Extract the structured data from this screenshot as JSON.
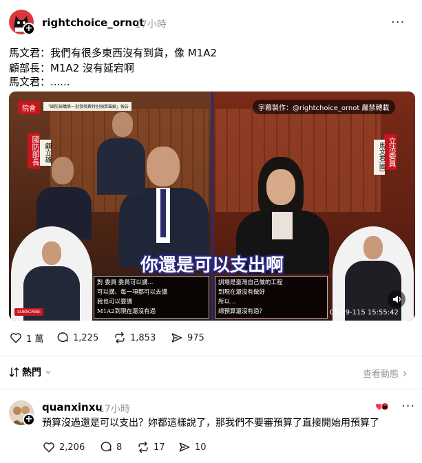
{
  "post": {
    "username": "rightchoice_ornot",
    "time": "17小時",
    "more_label": "···",
    "lines": [
      "馬文君：我們有很多東西沒有到貨，像 M1A2",
      "顧部長：M1A2 沒有延宕啊",
      "馬文君：......"
    ],
    "video": {
      "tag_left": "院會",
      "banner": "「國防採購第一批發價費特別預算籌編」報告",
      "watermark": "字幕製作：@rightchoice_ornot 嚴禁轉載",
      "speaker_left_title": "國防部長",
      "speaker_left_name": "顧立雄",
      "speaker_right_title": "立法委員",
      "speaker_right_name": "馬文君(國)",
      "subtitle": "你還是可以支出啊",
      "caption_left": [
        "對 委員 委員可以講...",
        "可以講、每一項都可以去講",
        "我也可以要講",
        "M1A2到現在還沒有過"
      ],
      "caption_right": [
        "訓場是臺灣自己做的工程",
        "到現在還沒有做好",
        "所以...",
        "總預算還沒有過？"
      ],
      "timestamp": "05-19-115 15:55:42",
      "subscribe": "SUBSCRIBE"
    },
    "stats": {
      "likes": "1 萬",
      "comments": "1,225",
      "reposts": "1,853",
      "shares": "975"
    }
  },
  "sort": {
    "label": "熱門",
    "view_activity": "查看動態"
  },
  "reply": {
    "username": "quanxinxu",
    "time": "17小時",
    "more_label": "···",
    "text": "預算沒過還是可以支出？妳都這樣說了，那我們不要審預算了直接開始用預算了",
    "stats": {
      "likes": "2,206",
      "comments": "8",
      "reposts": "17",
      "shares": "10"
    }
  }
}
